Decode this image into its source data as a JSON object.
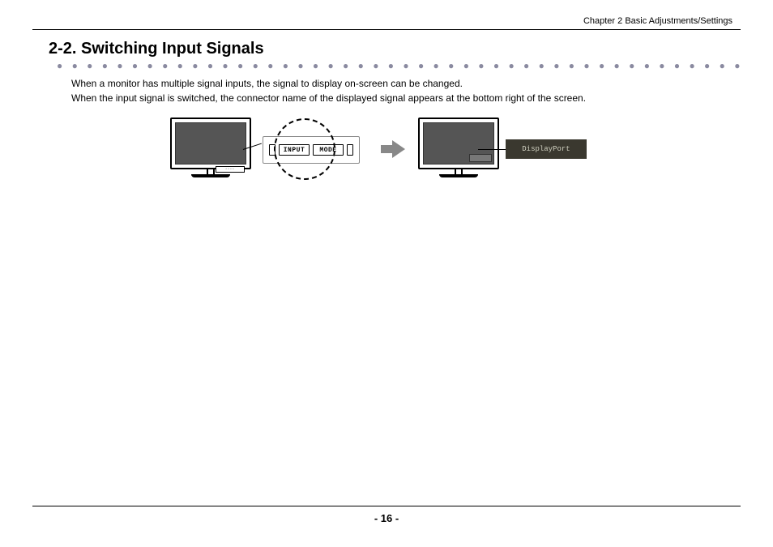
{
  "chapter_header": "Chapter 2   Basic Adjustments/Settings",
  "section_title": "2-2.  Switching Input Signals",
  "paragraph1": "When a monitor has multiple signal inputs, the signal to display on-screen can be changed.",
  "paragraph2": "When the input signal is switched, the connector name of the displayed signal appears at the bottom right of the screen.",
  "buttons": {
    "input": "INPUT",
    "mode": "MODE"
  },
  "connector_label": "DisplayPort",
  "page_number": "- 16 -"
}
